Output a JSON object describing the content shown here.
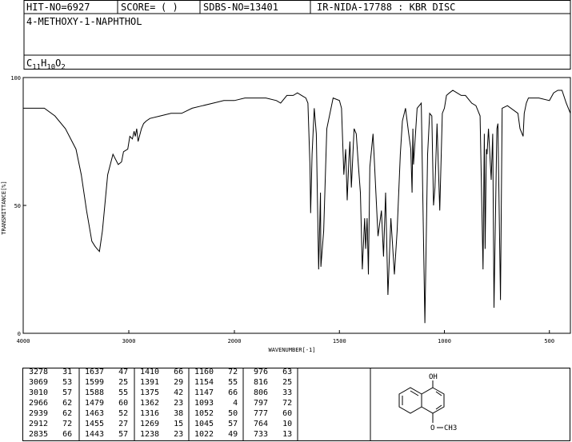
{
  "header": {
    "hit_no": "HIT-NO=6927",
    "score_label": "SCORE=",
    "score_value": "(  )",
    "sdbs_no": "SDBS-NO=13401",
    "ir_nida": "IR-NIDA-17788 : KBR DISC",
    "compound_name": "4-METHOXY-1-NAPHTHOL",
    "formula_parts": [
      "C",
      "11",
      "H",
      "10",
      "O",
      "2"
    ]
  },
  "chart_data": {
    "type": "line",
    "xlabel": "WAVENUMBER[-1]",
    "ylabel": "TRANSMITTANCE[%]",
    "x_ticks": [
      4000,
      3000,
      2000,
      1500,
      1000,
      500
    ],
    "y_ticks": [
      0,
      50,
      100
    ],
    "xlim": [
      4000,
      400
    ],
    "ylim": [
      0,
      100
    ],
    "series": [
      {
        "x": [
          4000,
          3900,
          3800,
          3700,
          3600,
          3500,
          3450,
          3400,
          3350,
          3320,
          3300,
          3278,
          3250,
          3200,
          3150,
          3100,
          3069,
          3050,
          3010,
          2990,
          2966,
          2950,
          2939,
          2925,
          2912,
          2880,
          2860,
          2835,
          2800,
          2700,
          2600,
          2500,
          2400,
          2300,
          2200,
          2100,
          2000,
          1950,
          1900,
          1850,
          1800,
          1780,
          1750,
          1720,
          1700,
          1680,
          1660,
          1650,
          1640,
          1637,
          1630,
          1620,
          1610,
          1599,
          1590,
          1588,
          1575,
          1560,
          1530,
          1500,
          1490,
          1479,
          1470,
          1463,
          1455,
          1450,
          1443,
          1430,
          1420,
          1410,
          1400,
          1391,
          1380,
          1375,
          1368,
          1362,
          1355,
          1340,
          1316,
          1300,
          1290,
          1280,
          1269,
          1255,
          1238,
          1225,
          1210,
          1200,
          1185,
          1170,
          1160,
          1154,
          1150,
          1147,
          1130,
          1110,
          1093,
          1080,
          1070,
          1060,
          1052,
          1045,
          1035,
          1022,
          1010,
          1000,
          990,
          976,
          960,
          940,
          920,
          900,
          870,
          850,
          830,
          816,
          810,
          806,
          800,
          797,
          790,
          777,
          770,
          764,
          750,
          745,
          733,
          725,
          700,
          650,
          640,
          625,
          620,
          610,
          600,
          550,
          500,
          480,
          460,
          440,
          420,
          400
        ],
        "y": [
          88,
          88,
          88,
          85,
          80,
          72,
          62,
          48,
          36,
          34,
          33,
          32,
          40,
          62,
          70,
          66,
          67,
          71,
          72,
          77,
          76,
          79,
          77,
          80,
          75,
          80,
          82,
          83,
          84,
          85,
          86,
          86,
          88,
          89,
          90,
          91,
          91,
          92,
          92,
          92,
          91,
          90,
          93,
          93,
          94,
          93,
          92,
          90,
          65,
          47,
          70,
          88,
          78,
          25,
          55,
          26,
          40,
          80,
          92,
          91,
          88,
          62,
          72,
          52,
          68,
          75,
          57,
          80,
          78,
          66,
          55,
          25,
          45,
          33,
          45,
          23,
          65,
          78,
          38,
          48,
          30,
          55,
          15,
          45,
          23,
          40,
          70,
          83,
          88,
          78,
          72,
          55,
          80,
          66,
          88,
          90,
          4,
          70,
          86,
          85,
          50,
          57,
          82,
          48,
          86,
          88,
          93,
          94,
          95,
          94,
          93,
          93,
          90,
          89,
          85,
          25,
          78,
          33,
          72,
          70,
          80,
          60,
          78,
          10,
          80,
          82,
          13,
          88,
          89,
          86,
          80,
          77,
          86,
          90,
          92,
          92,
          91,
          94,
          95,
          95,
          90,
          86
        ]
      }
    ],
    "peak_table": [
      [
        [
          3278,
          31
        ],
        [
          3069,
          53
        ],
        [
          3010,
          57
        ],
        [
          2966,
          62
        ],
        [
          2939,
          62
        ],
        [
          2912,
          72
        ],
        [
          2835,
          66
        ]
      ],
      [
        [
          1637,
          47
        ],
        [
          1599,
          25
        ],
        [
          1588,
          55
        ],
        [
          1479,
          60
        ],
        [
          1463,
          52
        ],
        [
          1455,
          27
        ],
        [
          1443,
          57
        ]
      ],
      [
        [
          1410,
          66
        ],
        [
          1391,
          29
        ],
        [
          1375,
          42
        ],
        [
          1362,
          23
        ],
        [
          1316,
          38
        ],
        [
          1269,
          15
        ],
        [
          1238,
          23
        ]
      ],
      [
        [
          1160,
          72
        ],
        [
          1154,
          55
        ],
        [
          1147,
          66
        ],
        [
          1093,
          4
        ],
        [
          1052,
          50
        ],
        [
          1045,
          57
        ],
        [
          1022,
          49
        ]
      ],
      [
        [
          976,
          63
        ],
        [
          816,
          25
        ],
        [
          806,
          33
        ],
        [
          797,
          72
        ],
        [
          777,
          60
        ],
        [
          764,
          10
        ],
        [
          733,
          13
        ]
      ]
    ]
  },
  "structure": {
    "oh_label": "OH",
    "o_label": "O",
    "ch3_label": "CH3"
  }
}
